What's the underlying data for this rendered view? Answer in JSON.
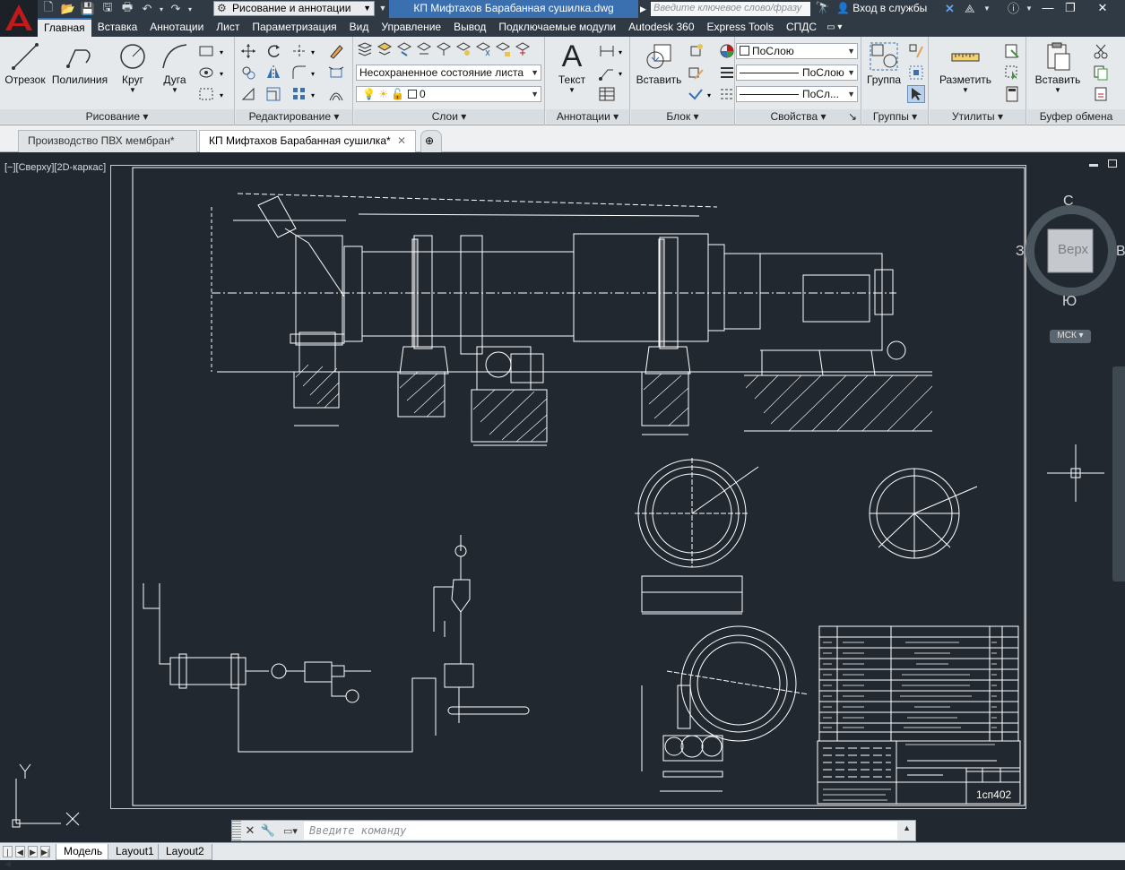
{
  "titlebar": {
    "workspace": "Рисование и аннотации",
    "document_title": "КП Мифтахов Барабанная сушилка.dwg",
    "search_placeholder": "Введите ключевое слово/фразу",
    "signin": "Вход в службы"
  },
  "menu": [
    "Главная",
    "Вставка",
    "Аннотации",
    "Лист",
    "Параметризация",
    "Вид",
    "Управление",
    "Вывод",
    "Подключаемые модули",
    "Autodesk 360",
    "Express Tools",
    "СПДС"
  ],
  "ribbon": {
    "draw": {
      "title": "Рисование",
      "line": "Отрезок",
      "polyline": "Полилиния",
      "circle": "Круг",
      "arc": "Дуга"
    },
    "modify": {
      "title": "Редактирование"
    },
    "layers": {
      "title": "Слои",
      "state": "Несохраненное состояние листа",
      "current_layer": "0"
    },
    "annotation": {
      "title": "Аннотации",
      "text": "Текст"
    },
    "block": {
      "title": "Блок",
      "insert": "Вставить"
    },
    "properties": {
      "title": "Свойства",
      "color": "ПоСлою",
      "linetype": "ПоСлою",
      "lineweight": "ПоСл..."
    },
    "groups": {
      "title": "Группы",
      "group": "Группа"
    },
    "utilities": {
      "title": "Утилиты",
      "measure": "Разметить"
    },
    "clipboard": {
      "title": "Буфер обмена",
      "paste": "Вставить"
    }
  },
  "doc_tabs": [
    "Производство ПВХ мембран*",
    "КП Мифтахов Барабанная сушилка*"
  ],
  "viewport_label": "[−][Сверху][2D-каркас]",
  "viewcube": {
    "n": "С",
    "s": "Ю",
    "w": "З",
    "e": "В",
    "face": "Верх",
    "wcs": "МСК"
  },
  "ucs": {
    "x": "X",
    "y": "Y"
  },
  "command_placeholder": "Введите команду",
  "layout_tabs": [
    "Модель",
    "Layout1",
    "Layout2"
  ],
  "drawing": {
    "title_code": "1сп402"
  },
  "colors": {
    "ribbon_bg": "#e6e9ec",
    "canvas_bg": "#212830",
    "accent": "#3a6fb0",
    "app_red": "#c21a1a"
  }
}
